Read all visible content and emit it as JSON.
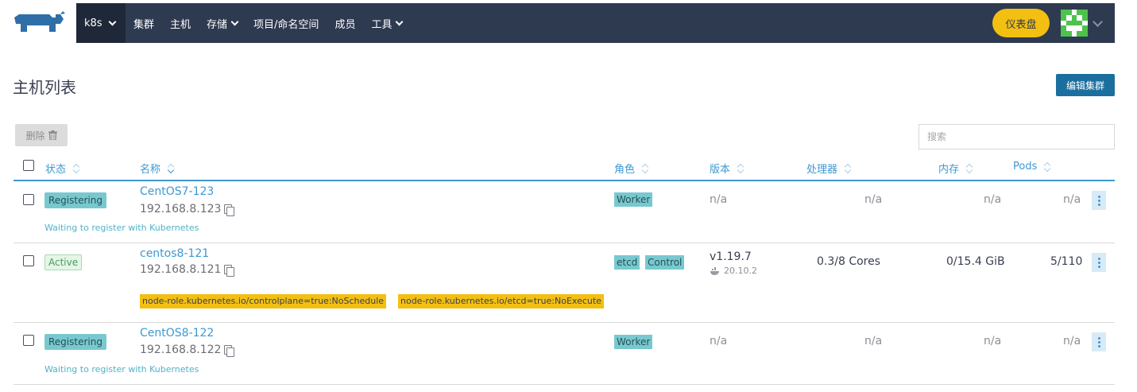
{
  "nav": {
    "cluster": "k8s",
    "items": [
      {
        "label": "集群",
        "dropdown": false
      },
      {
        "label": "主机",
        "dropdown": false
      },
      {
        "label": "存储",
        "dropdown": true
      },
      {
        "label": "项目/命名空间",
        "dropdown": false
      },
      {
        "label": "成员",
        "dropdown": false
      },
      {
        "label": "工具",
        "dropdown": true
      }
    ],
    "dashboard_button": "仪表盘",
    "colors": {
      "bar": "#2e3a50",
      "accent": "#f3c012"
    }
  },
  "header": {
    "title": "主机列表",
    "edit_button": "编辑集群"
  },
  "toolbar": {
    "delete_button": "删除",
    "search_placeholder": "搜索"
  },
  "table": {
    "columns": [
      "状态",
      "名称",
      "角色",
      "版本",
      "处理器",
      "内存",
      "Pods"
    ],
    "rows": [
      {
        "state": "Registering",
        "name": "CentOS7-123",
        "ip": "192.168.8.123",
        "note": "Waiting to register with Kubernetes",
        "roles": [
          "Worker"
        ],
        "version": "n/a",
        "cpu": "n/a",
        "memory": "n/a",
        "pods": "n/a"
      },
      {
        "state": "Active",
        "name": "centos8-121",
        "ip": "192.168.8.121",
        "roles": [
          "etcd",
          "Control"
        ],
        "version": "v1.19.7",
        "docker_version": "20.10.2",
        "cpu": "0.3/8 Cores",
        "memory": "0/15.4 GiB",
        "pods": "5/110",
        "taints": [
          "node-role.kubernetes.io/controlplane=true:NoSchedule",
          "node-role.kubernetes.io/etcd=true:NoExecute"
        ]
      },
      {
        "state": "Registering",
        "name": "CentOS8-122",
        "ip": "192.168.8.122",
        "note": "Waiting to register with Kubernetes",
        "roles": [
          "Worker"
        ],
        "version": "n/a",
        "cpu": "n/a",
        "memory": "n/a",
        "pods": "n/a"
      }
    ]
  }
}
